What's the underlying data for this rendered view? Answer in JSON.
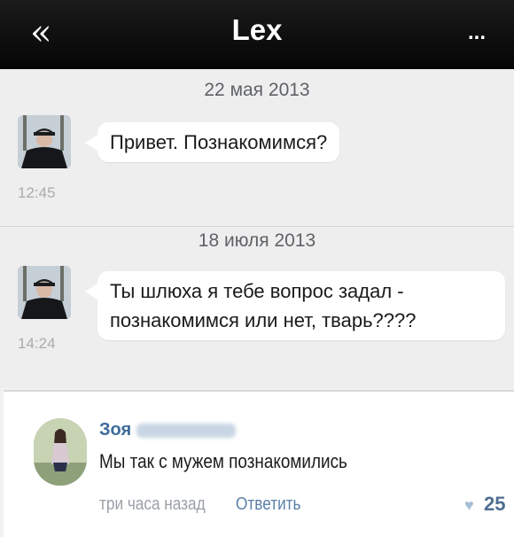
{
  "header": {
    "back_icon": "«",
    "title": "Lex",
    "more_icon": "..."
  },
  "messages": [
    {
      "date": "22 мая 2013",
      "text_lines": [
        "Привет. Познакомимся?"
      ],
      "time": "12:45"
    },
    {
      "date": "18 июля 2013",
      "text_lines": [
        "Ты шлюха я тебе вопрос задал -",
        "познакомимся или нет, тварь????"
      ],
      "time": "14:24"
    }
  ],
  "comment": {
    "author": "Зоя",
    "text": "Мы так с мужем познакомились",
    "ago": "три часа назад",
    "reply_label": "Ответить",
    "like_icon": "♥",
    "likes": "25"
  },
  "colors": {
    "header_bg": "#0b0b0b",
    "chat_bg": "#eeeeef",
    "bubble_bg": "#ffffff",
    "link": "#3d6b9a"
  }
}
